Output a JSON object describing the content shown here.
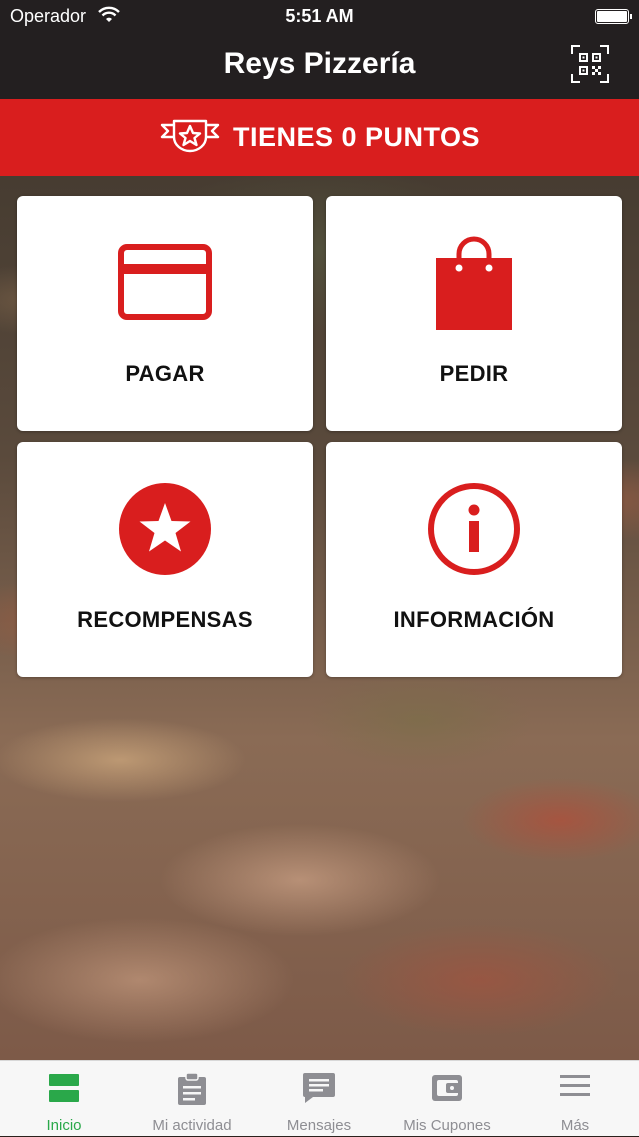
{
  "status_bar": {
    "carrier": "Operador",
    "time": "5:51 AM"
  },
  "navbar": {
    "title": "Reys Pizzería",
    "qr_icon": "qr-code-icon"
  },
  "points_banner": {
    "label": "TIENES 0 PUNTOS",
    "icon": "star-badge-icon"
  },
  "colors": {
    "accent_red": "#d91e1e",
    "dark_bar": "#231f20",
    "active_tab": "#2aa84a"
  },
  "tiles": [
    {
      "label": "PAGAR",
      "icon": "credit-card-icon"
    },
    {
      "label": "PEDIR",
      "icon": "shopping-bag-icon"
    },
    {
      "label": "RECOMPENSAS",
      "icon": "star-circle-icon"
    },
    {
      "label": "INFORMACIÓN",
      "icon": "info-circle-icon"
    }
  ],
  "tabbar": {
    "items": [
      {
        "label": "Inicio",
        "icon": "home-icon",
        "active": true
      },
      {
        "label": "Mi actividad",
        "icon": "clipboard-icon",
        "active": false
      },
      {
        "label": "Mensajes",
        "icon": "message-icon",
        "active": false
      },
      {
        "label": "Mis Cupones",
        "icon": "wallet-icon",
        "active": false
      },
      {
        "label": "Más",
        "icon": "menu-icon",
        "active": false
      }
    ]
  }
}
